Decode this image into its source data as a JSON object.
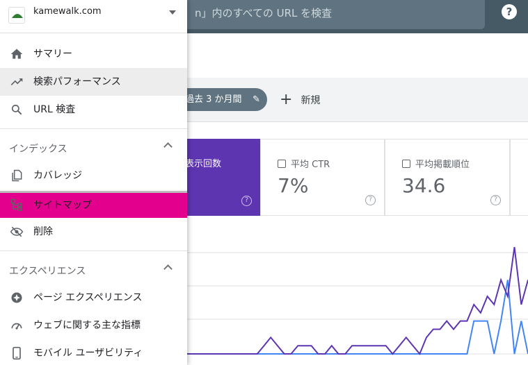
{
  "top_bar": {
    "search_placeholder_visible": "n」内のすべての URL を検査",
    "help_icon": "help-icon",
    "help_label": "?"
  },
  "filters": {
    "date_chip": "過去 3 か月間",
    "new_label": "新規",
    "new_icon": "plus-icon"
  },
  "metrics": {
    "impressions": {
      "label": "表示回数",
      "help": "?"
    },
    "ctr": {
      "label": "平均 CTR",
      "value": "7%",
      "help": "?"
    },
    "position": {
      "label": "平均掲載順位",
      "value": "34.6",
      "help": "?"
    }
  },
  "drawer": {
    "property": {
      "name": "kamewalk.com",
      "icon": "favicon-icon"
    },
    "top_items": [
      {
        "label": "サマリー",
        "icon": "home-icon"
      },
      {
        "label": "検索パフォーマンス",
        "icon": "trending-up-icon"
      },
      {
        "label": "URL 検査",
        "icon": "search-icon"
      }
    ],
    "sections": [
      {
        "title": "インデックス",
        "items": [
          {
            "label": "カバレッジ",
            "icon": "copy-icon"
          },
          {
            "label": "サイトマップ",
            "icon": "sitemap-icon"
          },
          {
            "label": "削除",
            "icon": "visibility-off-icon"
          }
        ]
      },
      {
        "title": "エクスペリエンス",
        "items": [
          {
            "label": "ページ エクスペリエンス",
            "icon": "page-experience-icon"
          },
          {
            "label": "ウェブに関する主な指標",
            "icon": "speed-icon"
          },
          {
            "label": "モバイル ユーザビリティ",
            "icon": "smartphone-icon"
          }
        ]
      }
    ]
  },
  "colors": {
    "accent_purple": "#5e35b1",
    "active_highlight": "#e3008c",
    "top_bar": "#455a64",
    "clicks_line": "#4285f4",
    "impressions_line": "#5e35b1"
  },
  "chart_data": {
    "type": "line",
    "series": [
      {
        "values": [
          0,
          0,
          0,
          0,
          0,
          0,
          0,
          0,
          0,
          0,
          0,
          0,
          0,
          0,
          0,
          0,
          0,
          0,
          0,
          0,
          0,
          0,
          0,
          0,
          0,
          0,
          0,
          0,
          0,
          0,
          0,
          0,
          0,
          0,
          0,
          0,
          0,
          0,
          0,
          1,
          2,
          1,
          0,
          0,
          1,
          1,
          1,
          0,
          0,
          1,
          0,
          0,
          1,
          1,
          1,
          1,
          1,
          1,
          0,
          1,
          2,
          1,
          0,
          2,
          3,
          3,
          4,
          3,
          4,
          4,
          6,
          5,
          7,
          6,
          9,
          7,
          13,
          6,
          9
        ]
      },
      {
        "values": [
          0,
          0,
          0,
          0,
          0,
          0,
          0,
          0,
          0,
          0,
          0,
          0,
          0,
          0,
          0,
          0,
          0,
          0,
          0,
          0,
          0,
          0,
          0,
          0,
          0,
          0,
          0,
          0,
          0,
          0,
          0,
          0,
          0,
          0,
          0,
          0,
          0,
          0,
          0,
          0,
          0,
          0,
          0,
          0,
          0,
          0,
          0,
          0,
          0,
          0,
          0,
          0,
          0,
          0,
          0,
          0,
          0,
          0,
          0,
          0,
          0,
          0,
          0,
          0,
          0,
          0,
          0,
          0,
          0,
          0,
          4,
          4,
          4,
          0,
          4,
          9,
          0,
          4,
          0
        ]
      }
    ]
  }
}
